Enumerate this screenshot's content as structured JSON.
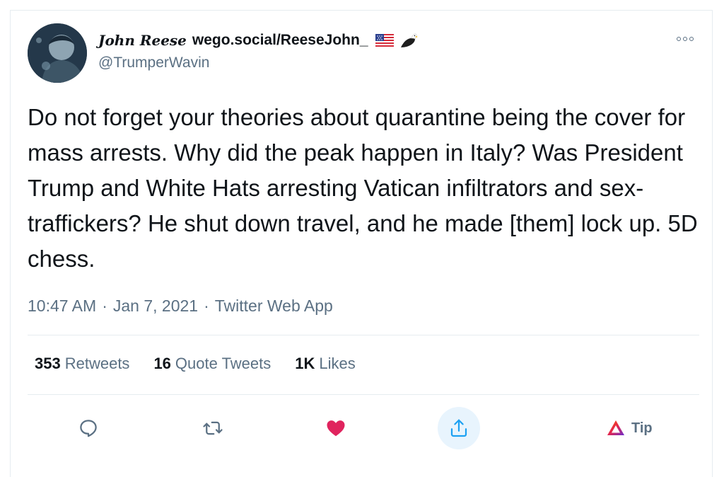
{
  "author": {
    "display_name": "John Reese",
    "name_suffix": "wego.social/ReeseJohn_",
    "handle": "@TrumperWavin",
    "name_emojis": [
      "us-flag-icon",
      "eagle-icon"
    ]
  },
  "tweet": {
    "text": "Do not forget your theories about quarantine being the cover for mass arrests. Why did the peak happen in Italy? Was President Trump and White Hats arresting Vatican infiltrators and sex-traffickers? He shut down travel, and he made [them] lock up. 5D chess.",
    "time": "10:47 AM",
    "date": "Jan 7, 2021",
    "separator": "·",
    "source": "Twitter Web App"
  },
  "stats": [
    {
      "count": "353",
      "label": "Retweets"
    },
    {
      "count": "16",
      "label": "Quote Tweets"
    },
    {
      "count": "1K",
      "label": "Likes"
    }
  ],
  "actions": {
    "reply": "reply-icon",
    "retweet": "retweet-icon",
    "like": "heart-icon",
    "share": "share-icon",
    "tip": {
      "icon": "tip-triangle-icon",
      "label": "Tip"
    }
  },
  "colors": {
    "text": "#0f1419",
    "secondary": "#5b7083",
    "accent": "#1da1f2",
    "like": "#e0245e",
    "divider": "#e6ecf0",
    "share_bg": "#e8f4fd"
  }
}
